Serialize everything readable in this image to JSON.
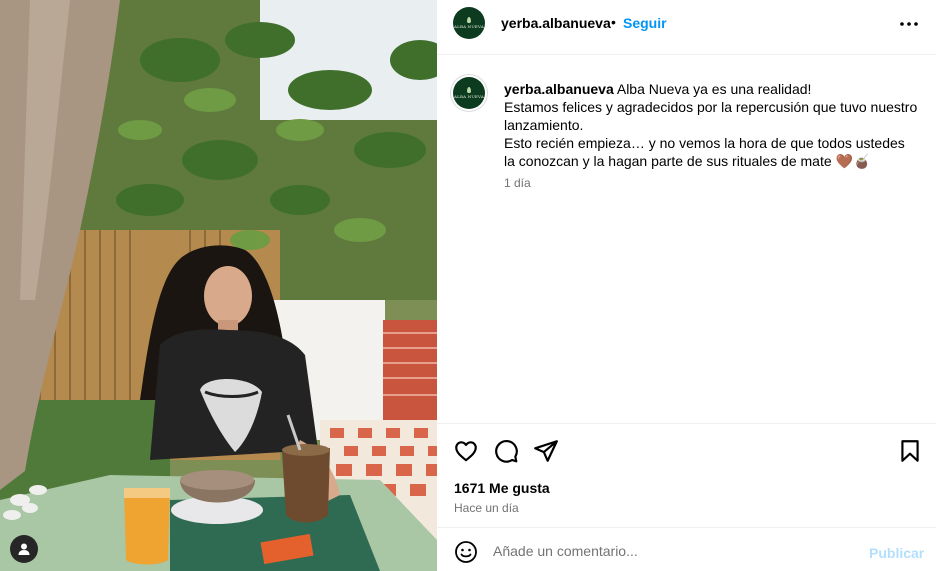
{
  "post": {
    "username": "yerba.albanueva",
    "follow_label": "Seguir",
    "separator": "•",
    "avatar_brand": "ALBA NUEVA",
    "caption": {
      "username": "yerba.albanueva",
      "lines": [
        "Alba Nueva ya es una realidad!",
        "Estamos felices y agradecidos por la repercusión que tuvo nuestro lanzamiento.",
        "Esto recién empieza… y no vemos la hora de que todos ustedes la conozcan y la hagan parte de sus rituales de mate 🤎🧉"
      ],
      "time": "1 día"
    },
    "likes": "1671 Me gusta",
    "posted_ago": "Hace un día",
    "comment_placeholder": "Añade un comentario...",
    "publish_label": "Publicar"
  },
  "icons": {
    "header_more": "more-horizontal-icon",
    "like": "heart-icon",
    "comment": "comment-icon",
    "share": "share-icon",
    "save": "bookmark-icon",
    "emoji": "emoji-icon",
    "tagged": "user-tag-icon"
  },
  "colors": {
    "link": "#0095f6",
    "publish_disabled": "#b2dffc",
    "muted": "#737373",
    "avatar_bg": "#0d3b1f"
  }
}
